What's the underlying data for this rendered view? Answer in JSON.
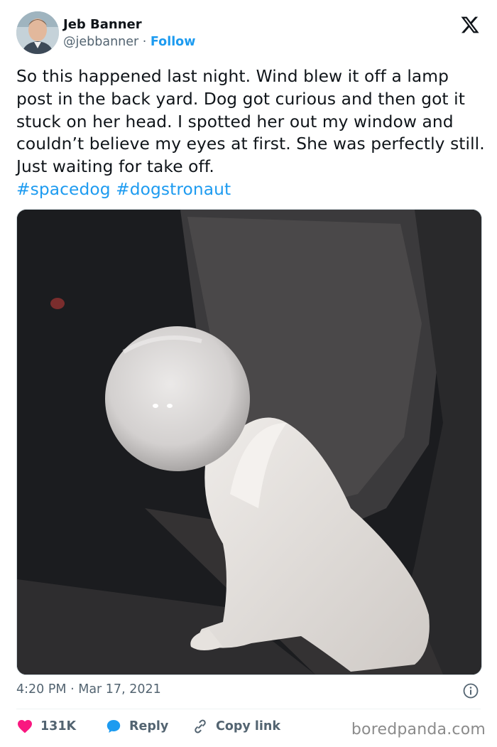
{
  "author": {
    "name": "Jeb Banner",
    "handle": "@jebbanner",
    "separator": " · ",
    "follow_label": "Follow"
  },
  "tweet": {
    "text": "So this happened last night. Wind blew it off a lamp post in the back yard. Dog got curious and then got it stuck on her head. I spotted her out my window and couldn’t believe my eyes at first. She was perfectly still. Just waiting for take off.",
    "hashtags": [
      "#spacedog",
      "#dogstronaut"
    ]
  },
  "timestamp": {
    "time": "4:20 PM",
    "separator": " · ",
    "date": "Mar 17, 2021"
  },
  "actions": {
    "likes_count": "131K",
    "reply_label": "Reply",
    "copy_link_label": "Copy link"
  },
  "watermark": "boredpanda.com",
  "colors": {
    "link_blue": "#1d9bf0",
    "like_red": "#f91880",
    "text_dark": "#0f1419",
    "text_gray": "#536471"
  },
  "icons": [
    "x-logo-icon",
    "info-icon",
    "heart-icon",
    "reply-bubble-icon",
    "link-icon"
  ]
}
